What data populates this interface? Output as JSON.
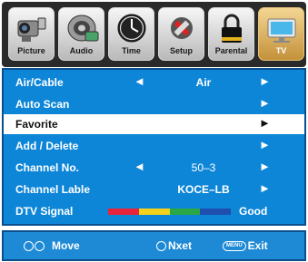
{
  "tabs": [
    {
      "label": "Picture",
      "icon": "camcorder-icon"
    },
    {
      "label": "Audio",
      "icon": "speaker-icon"
    },
    {
      "label": "Time",
      "icon": "clock-icon"
    },
    {
      "label": "Setup",
      "icon": "wrench-icon"
    },
    {
      "label": "Parental",
      "icon": "lock-icon"
    },
    {
      "label": "TV",
      "icon": "tv-icon"
    }
  ],
  "active_tab": "TV",
  "menu": {
    "air_cable": {
      "label": "Air/Cable",
      "left_arrow": "◄",
      "value": "Air",
      "right_arrow": "►"
    },
    "auto_scan": {
      "label": "Auto Scan",
      "right_arrow": "►"
    },
    "favorite": {
      "label": "Favorite",
      "right_arrow": "►"
    },
    "add_delete": {
      "label": "Add / Delete",
      "right_arrow": "►"
    },
    "channel_no": {
      "label": "Channel No.",
      "left_arrow": "◄",
      "value": "50–3",
      "right_arrow": "►"
    },
    "channel_label": {
      "label": "Channel Lable",
      "value": "KOCE–LB",
      "right_arrow": "►"
    },
    "dtv_signal": {
      "label": "DTV Signal",
      "status": "Good",
      "bar_colors": [
        "#e8243a",
        "#f2d21b",
        "#2aa845",
        "#1f4fae"
      ]
    }
  },
  "selected_item": "Favorite",
  "hints": {
    "move": "Move",
    "next": "Nxet",
    "exit_key": "MENU",
    "exit": "Exit"
  },
  "colors": {
    "panel": "#0e86d8",
    "panel_border": "#0a4f8c",
    "active_tab": "#d9a94e",
    "selection": "#ffffff"
  }
}
